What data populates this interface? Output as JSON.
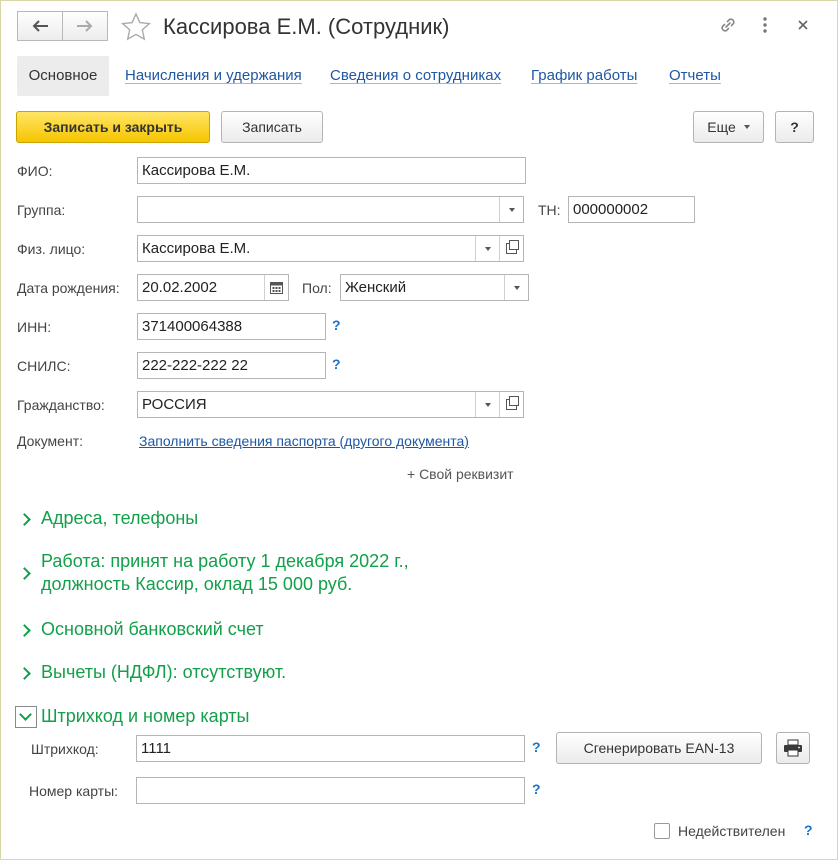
{
  "window": {
    "title": "Кассирова Е.М. (Сотрудник)"
  },
  "tabs": [
    {
      "label": "Основное"
    },
    {
      "label": "Начисления и удержания"
    },
    {
      "label": "Сведения о сотрудниках"
    },
    {
      "label": "График работы"
    },
    {
      "label": "Отчеты"
    }
  ],
  "toolbar": {
    "save_close_label": "Записать и закрыть",
    "save_label": "Записать",
    "more_label": "Еще",
    "help_label": "?"
  },
  "form": {
    "fio_label": "ФИО:",
    "fio_value": "Кассирова Е.М.",
    "group_label": "Группа:",
    "group_value": "",
    "tn_label": "ТН:",
    "tn_value": "000000002",
    "person_label": "Физ. лицо:",
    "person_value": "Кассирова Е.М.",
    "birth_label": "Дата рождения:",
    "birth_value": "20.02.2002",
    "gender_label": "Пол:",
    "gender_value": "Женский",
    "inn_label": "ИНН:",
    "inn_value": "371400064388",
    "snils_label": "СНИЛС:",
    "snils_value": "222-222-222 22",
    "citizenship_label": "Гражданство:",
    "citizenship_value": "РОССИЯ",
    "document_label": "Документ:",
    "document_link": "Заполнить сведения паспорта (другого документа)",
    "own_attr_label": "+ Свой реквизит",
    "help_mark": "?"
  },
  "sections": {
    "addresses": "Адреса, телефоны",
    "work_line1": "Работа: принят на работу 1 декабря 2022 г.,",
    "work_line2": "должность Кассир, оклад 15 000 руб.",
    "bank": "Основной банковский счет",
    "deductions": "Вычеты (НДФЛ): отсутствуют.",
    "barcode": "Штрихкод и номер карты"
  },
  "barcode": {
    "barcode_label": "Штрихкод:",
    "barcode_value": "1111",
    "generate_label": "Сгенерировать EAN-13",
    "card_label": "Номер карты:",
    "card_value": "",
    "invalid_label": "Недействителен"
  },
  "colors": {
    "accent_green": "#12a04a",
    "link_blue": "#1f57a3",
    "primary_yellow": "#f6c500"
  }
}
